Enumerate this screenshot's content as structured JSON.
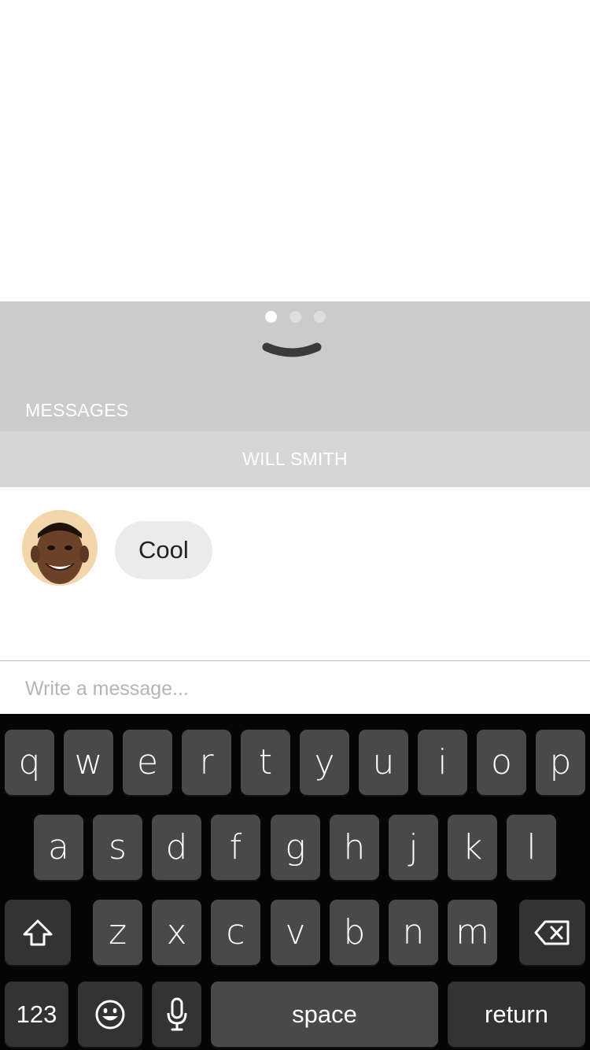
{
  "panel": {
    "page_dots": {
      "count": 3,
      "active_index": 0
    },
    "title": "MESSAGES"
  },
  "conversation": {
    "contact_name": "WILL SMITH",
    "messages": [
      {
        "text": "Cool",
        "sender": "contact"
      }
    ]
  },
  "composer": {
    "placeholder": "Write a message...",
    "value": ""
  },
  "keyboard": {
    "row1": [
      "q",
      "w",
      "e",
      "r",
      "t",
      "y",
      "u",
      "i",
      "o",
      "p"
    ],
    "row2": [
      "a",
      "s",
      "d",
      "f",
      "g",
      "h",
      "j",
      "k",
      "l"
    ],
    "row3": [
      "z",
      "x",
      "c",
      "v",
      "b",
      "n",
      "m"
    ],
    "numbers_label": "123",
    "space_label": "space",
    "return_label": "return",
    "shift_icon": "shift-icon",
    "delete_icon": "backspace-icon",
    "emoji_icon": "emoji-icon",
    "mic_icon": "microphone-icon"
  },
  "colors": {
    "panel_bg": "#cbcbcb",
    "contact_bar_bg": "#d6d6d6",
    "bubble_bg": "#ebebeb",
    "keyboard_bg": "#050505",
    "key_bg": "#494949",
    "special_key_bg": "#333333"
  }
}
